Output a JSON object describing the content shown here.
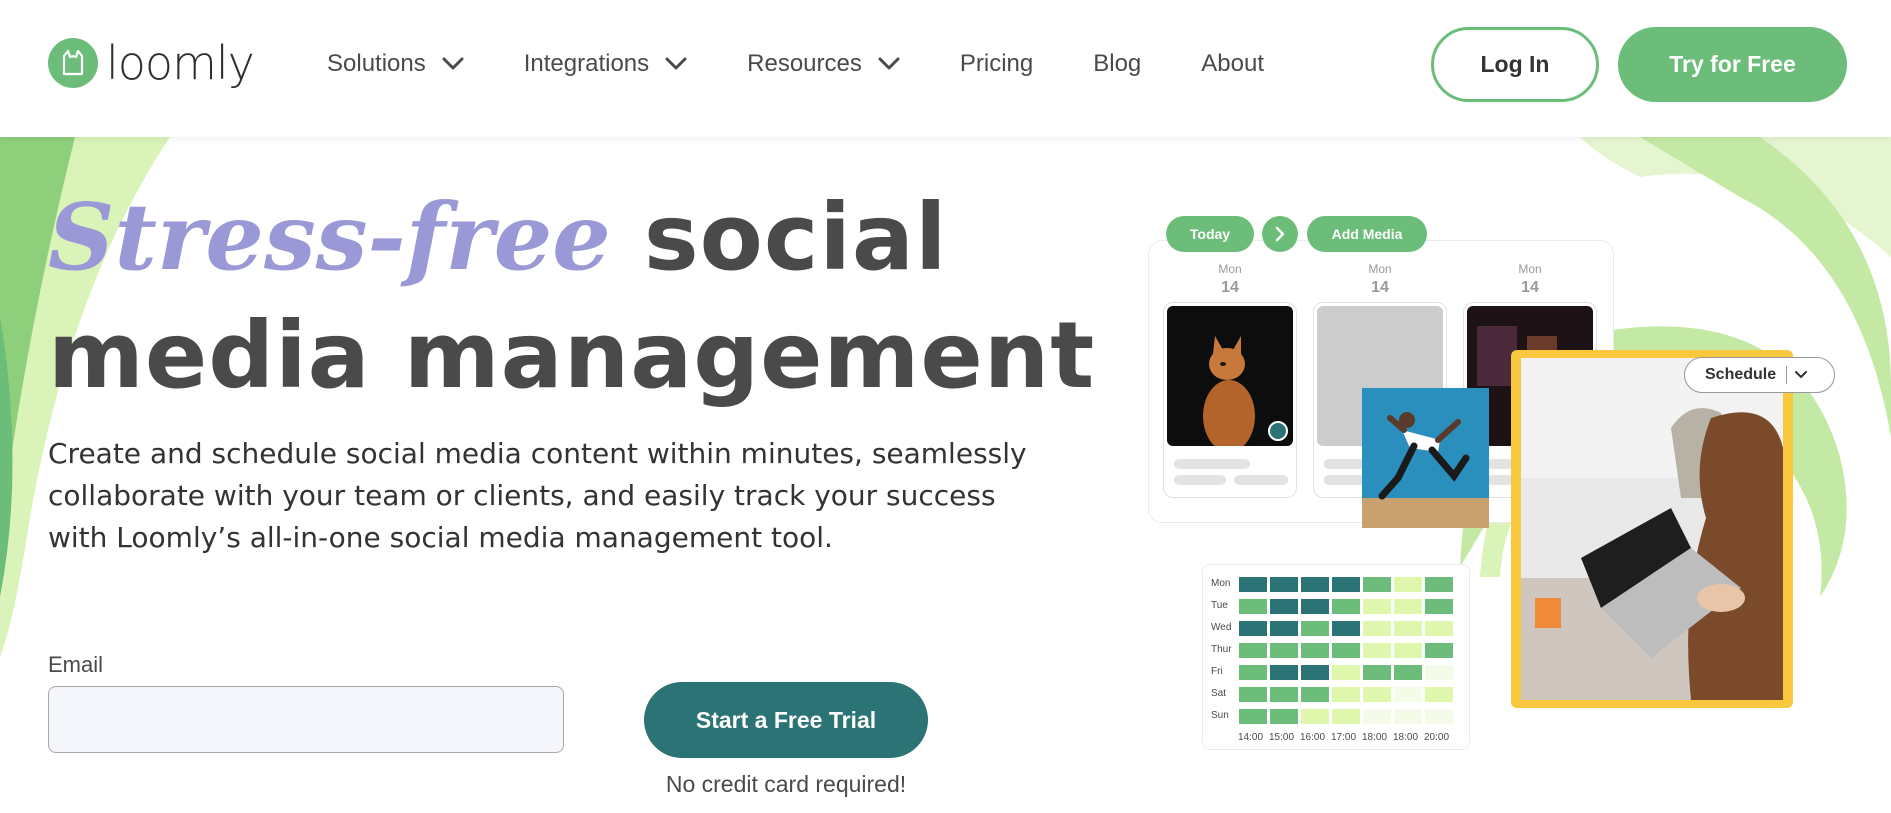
{
  "header": {
    "logo_text": "loomly",
    "nav": [
      {
        "label": "Solutions",
        "has_dropdown": true
      },
      {
        "label": "Integrations",
        "has_dropdown": true
      },
      {
        "label": "Resources",
        "has_dropdown": true
      },
      {
        "label": "Pricing",
        "has_dropdown": false
      },
      {
        "label": "Blog",
        "has_dropdown": false
      },
      {
        "label": "About",
        "has_dropdown": false
      }
    ],
    "login_label": "Log In",
    "try_label": "Try for Free"
  },
  "hero": {
    "headline_accent": "Stress-free",
    "headline_rest_line1": "social",
    "headline_line2": "media management",
    "subheading": "Create and schedule social media content within minutes, seamlessly collaborate with your team or clients, and easily track your success with Loomly’s all-in-one social media management tool.",
    "email_label": "Email",
    "email_value": "",
    "cta_label": "Start a Free Trial",
    "cta_note": "No credit card required!"
  },
  "illustration": {
    "today_label": "Today",
    "add_media_label": "Add Media",
    "days": [
      {
        "dow": "Mon",
        "date": "14"
      },
      {
        "dow": "Mon",
        "date": "14"
      },
      {
        "dow": "Mon",
        "date": "14"
      }
    ],
    "schedule_label": "Schedule",
    "heatmap": {
      "rows": [
        "Mon",
        "Tue",
        "Wed",
        "Thur",
        "Fri",
        "Sat",
        "Sun"
      ],
      "cols": [
        "14:00",
        "15:00",
        "16:00",
        "17:00",
        "18:00",
        "18:00",
        "20:00"
      ],
      "levels": [
        [
          3,
          3,
          3,
          3,
          2,
          1,
          2
        ],
        [
          2,
          3,
          3,
          2,
          1,
          1,
          2
        ],
        [
          3,
          3,
          2,
          3,
          1,
          1,
          1
        ],
        [
          2,
          2,
          2,
          2,
          1,
          1,
          2
        ],
        [
          2,
          3,
          3,
          1,
          2,
          2,
          0
        ],
        [
          2,
          2,
          2,
          1,
          1,
          0,
          1
        ],
        [
          2,
          2,
          1,
          1,
          0,
          0,
          0
        ]
      ]
    }
  },
  "colors": {
    "brand_green": "#6cbd79",
    "teal": "#2b7374",
    "lavender": "#9a98d6",
    "yellow": "#f9c83e"
  }
}
